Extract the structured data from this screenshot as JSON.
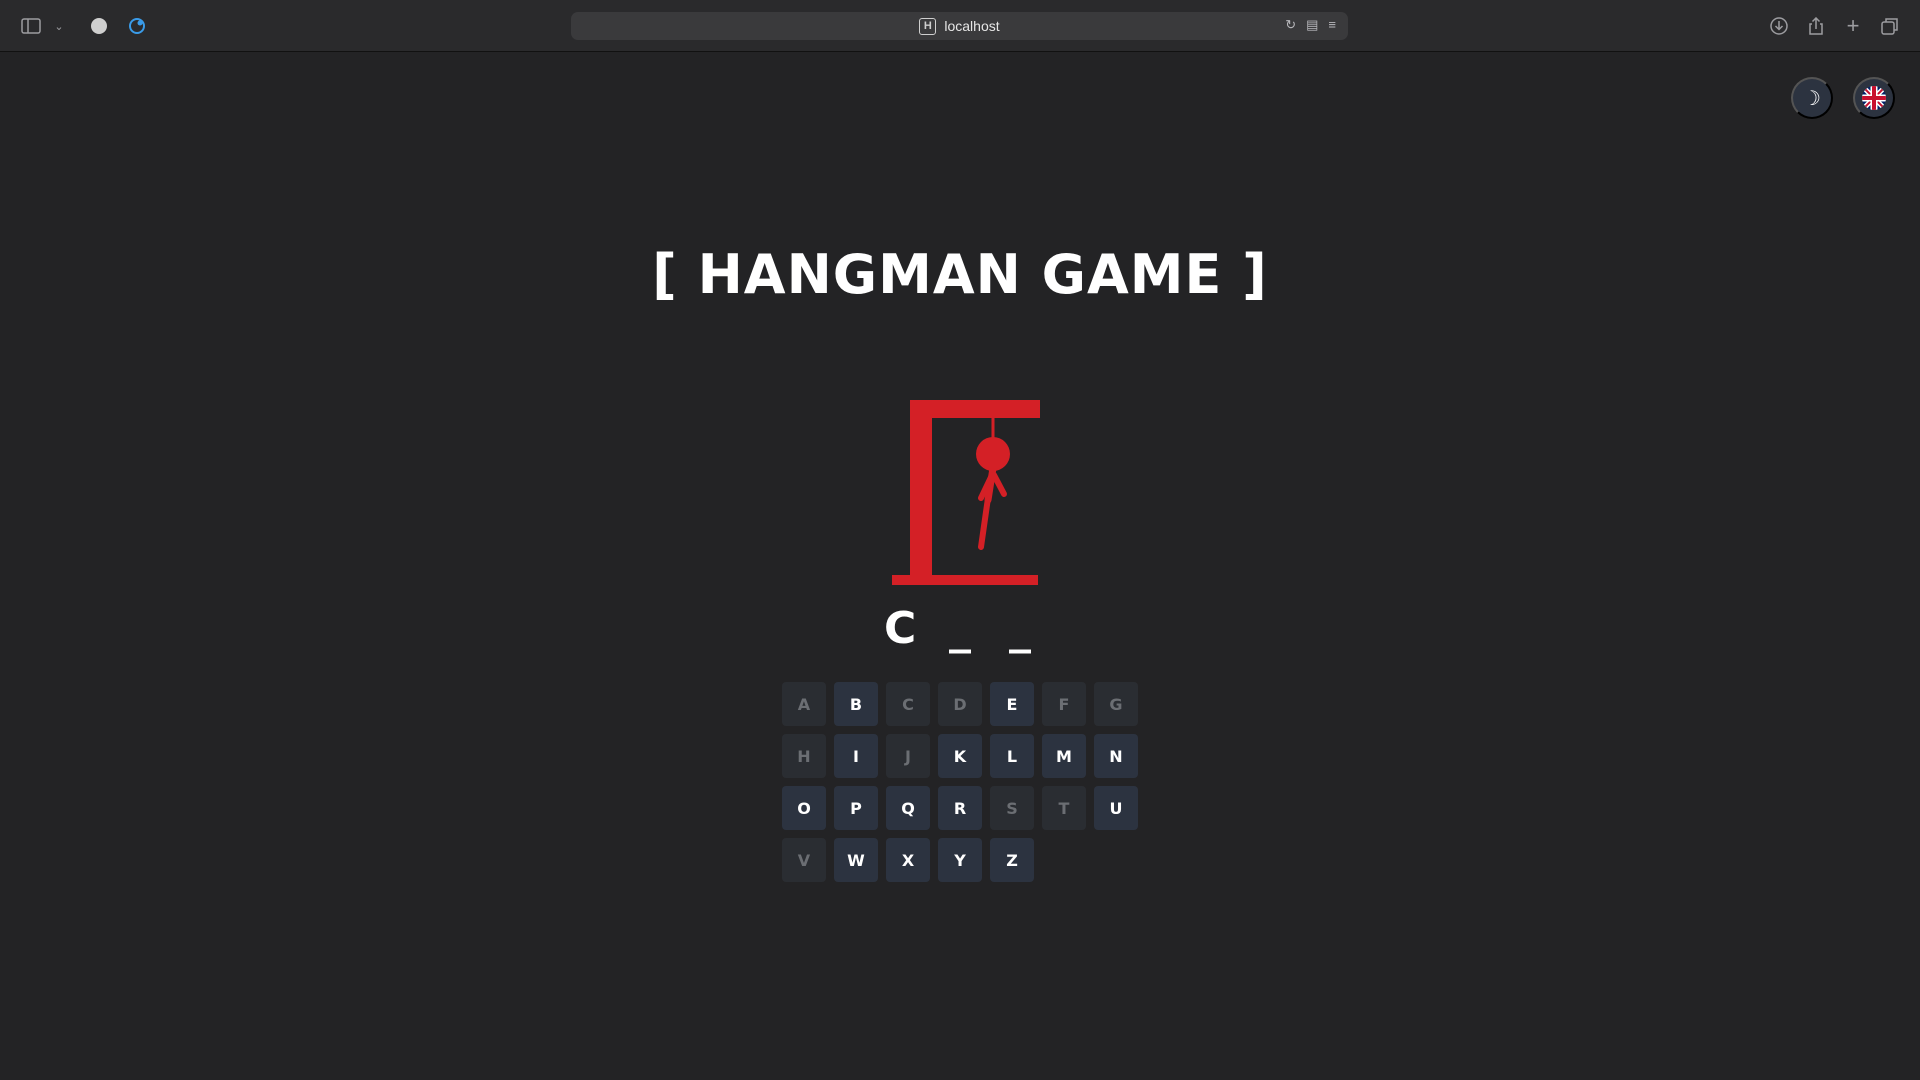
{
  "browser": {
    "url": "localhost",
    "favicon_letter": "H"
  },
  "page": {
    "title": "[ HANGMAN GAME ]",
    "theme_icon": "moon-icon",
    "language_icon": "uk-flag-icon"
  },
  "game": {
    "word_slots": [
      "C",
      "_",
      "_"
    ],
    "wrong_guesses_shown": "head, body, one arm, one leg",
    "keys": [
      {
        "letter": "A",
        "used": true
      },
      {
        "letter": "B",
        "used": false
      },
      {
        "letter": "C",
        "used": true
      },
      {
        "letter": "D",
        "used": true
      },
      {
        "letter": "E",
        "used": false
      },
      {
        "letter": "F",
        "used": true
      },
      {
        "letter": "G",
        "used": true
      },
      {
        "letter": "H",
        "used": true
      },
      {
        "letter": "I",
        "used": false
      },
      {
        "letter": "J",
        "used": true
      },
      {
        "letter": "K",
        "used": false
      },
      {
        "letter": "L",
        "used": false
      },
      {
        "letter": "M",
        "used": false
      },
      {
        "letter": "N",
        "used": false
      },
      {
        "letter": "O",
        "used": false
      },
      {
        "letter": "P",
        "used": false
      },
      {
        "letter": "Q",
        "used": false
      },
      {
        "letter": "R",
        "used": false
      },
      {
        "letter": "S",
        "used": true
      },
      {
        "letter": "T",
        "used": true
      },
      {
        "letter": "U",
        "used": false
      },
      {
        "letter": "V",
        "used": true
      },
      {
        "letter": "W",
        "used": false
      },
      {
        "letter": "X",
        "used": false
      },
      {
        "letter": "Y",
        "used": false
      },
      {
        "letter": "Z",
        "used": false
      }
    ]
  },
  "colors": {
    "background": "#232325",
    "gallows": "#d42026",
    "key_active": "#2c3340",
    "key_used": "#2a2d32"
  }
}
